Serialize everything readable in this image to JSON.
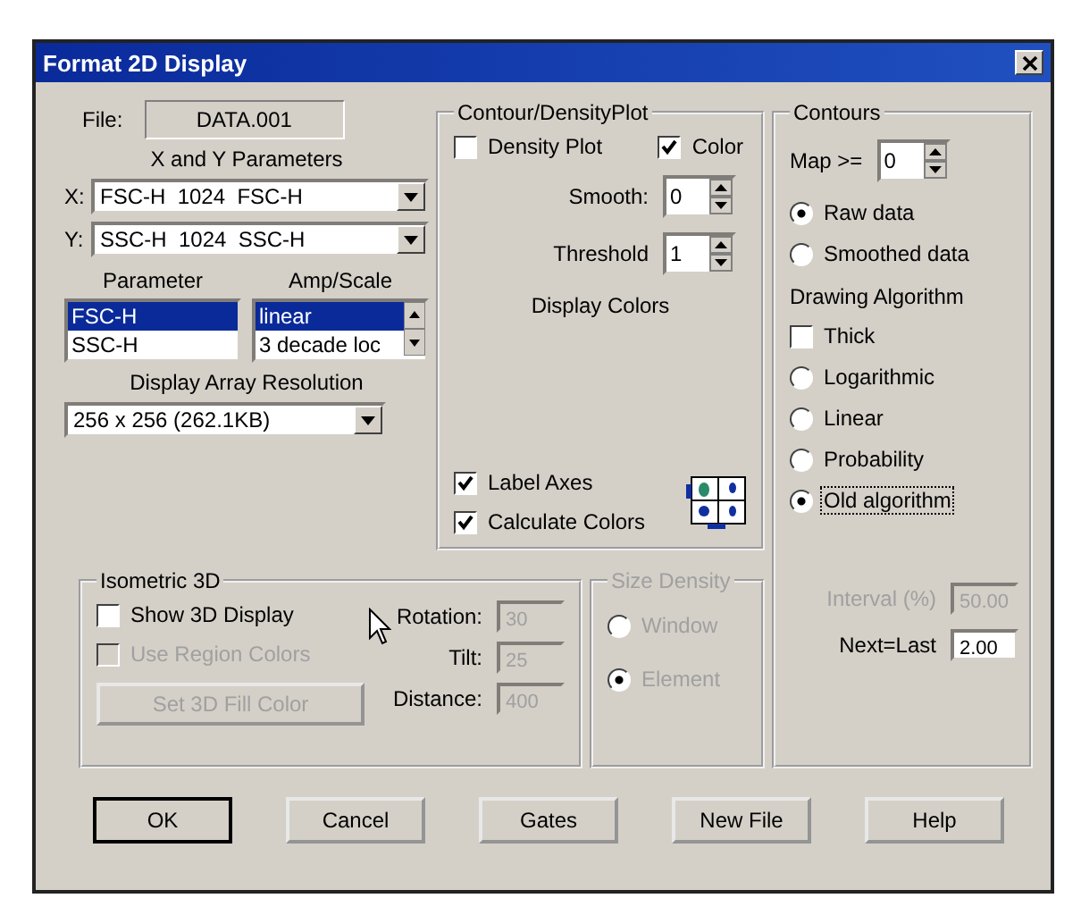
{
  "window": {
    "title": "Format 2D Display"
  },
  "file": {
    "label": "File:",
    "value": "DATA.001"
  },
  "xy_parameters": {
    "heading": "X and Y Parameters",
    "x": {
      "label": "X:",
      "value": "FSC-H  1024  FSC-H"
    },
    "y": {
      "label": "Y:",
      "value": "SSC-H  1024  SSC-H"
    }
  },
  "parameter_list": {
    "heading": "Parameter",
    "items": [
      {
        "label": "FSC-H",
        "selected": true
      },
      {
        "label": "SSC-H",
        "selected": false
      }
    ]
  },
  "amp_scale": {
    "heading": "Amp/Scale",
    "items": [
      {
        "label": "linear",
        "selected": true
      },
      {
        "label": "3 decade loc",
        "selected": false
      }
    ]
  },
  "resolution": {
    "heading": "Display Array Resolution",
    "value": "256 x 256 (262.1KB)"
  },
  "contour_density": {
    "title": "Contour/DensityPlot",
    "density_plot": {
      "label": "Density Plot",
      "checked": false
    },
    "color": {
      "label": "Color",
      "checked": true
    },
    "smooth": {
      "label": "Smooth:",
      "value": "0"
    },
    "threshold": {
      "label": "Threshold",
      "value": "1"
    },
    "display_colors": "Display Colors",
    "label_axes": {
      "label": "Label Axes",
      "checked": true
    },
    "calculate_colors": {
      "label": "Calculate Colors",
      "checked": true
    }
  },
  "contours": {
    "title": "Contours",
    "map": {
      "label": "Map >=",
      "value": "0"
    },
    "options": [
      {
        "kind": "radio",
        "label": "Raw data",
        "selected": true,
        "focused": false
      },
      {
        "kind": "radio",
        "label": "Smoothed data",
        "selected": false,
        "focused": false
      },
      {
        "kind": "heading",
        "label": "Drawing Algorithm"
      },
      {
        "kind": "checkbox",
        "label": "Thick",
        "checked": false
      },
      {
        "kind": "radio",
        "label": "Logarithmic",
        "selected": false,
        "focused": false
      },
      {
        "kind": "radio",
        "label": "Linear",
        "selected": false,
        "focused": false
      },
      {
        "kind": "radio",
        "label": "Probability",
        "selected": false,
        "focused": false
      },
      {
        "kind": "radio",
        "label": "Old algorithm",
        "selected": true,
        "focused": true
      }
    ],
    "fields": [
      {
        "label": "Interval (%)",
        "value": "50.00",
        "disabled": true
      },
      {
        "label": "Next=Last",
        "value": "2.00",
        "disabled": false
      }
    ]
  },
  "isometric": {
    "title": "Isometric 3D",
    "show_3d": {
      "label": "Show 3D Display",
      "checked": false,
      "disabled": false
    },
    "use_region_colors": {
      "label": "Use Region Colors",
      "checked": false,
      "disabled": true
    },
    "fill_button": {
      "label": "Set 3D Fill Color",
      "disabled": true
    },
    "fields": [
      {
        "label": "Rotation:",
        "value": "30",
        "disabled": true
      },
      {
        "label": "Tilt:",
        "value": "25",
        "disabled": true
      },
      {
        "label": "Distance:",
        "value": "400",
        "disabled": true
      }
    ]
  },
  "size_density": {
    "title": "Size Density",
    "disabled": true,
    "options": [
      {
        "label": "Window",
        "selected": false
      },
      {
        "label": "Element",
        "selected": true
      }
    ]
  },
  "buttons": [
    {
      "label": "OK",
      "default": true
    },
    {
      "label": "Cancel",
      "default": false
    },
    {
      "label": "Gates",
      "default": false
    },
    {
      "label": "New File",
      "default": false
    },
    {
      "label": "Help",
      "default": false
    }
  ]
}
